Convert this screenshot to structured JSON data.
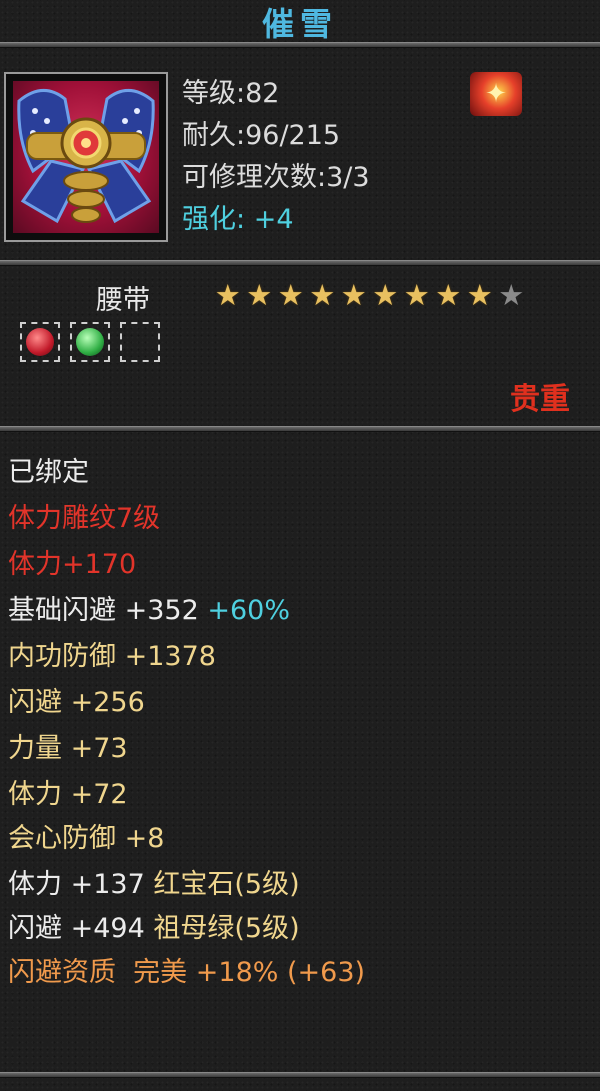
{
  "item": {
    "name": "催雪",
    "level": "等级:82",
    "durability": "耐久:96/215",
    "repair": "可修理次数:3/3",
    "enhance_label": "强化:",
    "enhance_value": "+4",
    "category": "腰带",
    "stars": {
      "filled": 9,
      "total": 10
    },
    "quality": "贵重",
    "fx_icon": "flame-emblem-icon"
  },
  "sockets": [
    {
      "gem": "ruby",
      "color": "#d8283a"
    },
    {
      "gem": "emerald",
      "color": "#2fb84a"
    },
    {
      "gem": "empty"
    }
  ],
  "attributes": {
    "bound": "已绑定",
    "engrave": "体力雕纹7级",
    "stamina_bonus": "体力+170",
    "base_dodge_label": "基础闪避",
    "base_dodge_value": "+352",
    "base_dodge_pct": "+60%",
    "inner_def_label": "内功防御",
    "inner_def_value": "+1378",
    "dodge_label": "闪避",
    "dodge_value": "+256",
    "power_label": "力量",
    "power_value": "+73",
    "stamina_label": "体力",
    "stamina_value": "+72",
    "crit_def_label": "会心防御",
    "crit_def_value": "+8",
    "gem1_stat": "体力",
    "gem1_value": "+137",
    "gem1_name": "红宝石(5级)",
    "gem2_stat": "闪避",
    "gem2_value": "+494",
    "gem2_name": "祖母绿(5级)",
    "aptitude_label": "闪避资质",
    "aptitude_grade": "完美",
    "aptitude_pct": "+18%",
    "aptitude_extra": "(+63)"
  }
}
